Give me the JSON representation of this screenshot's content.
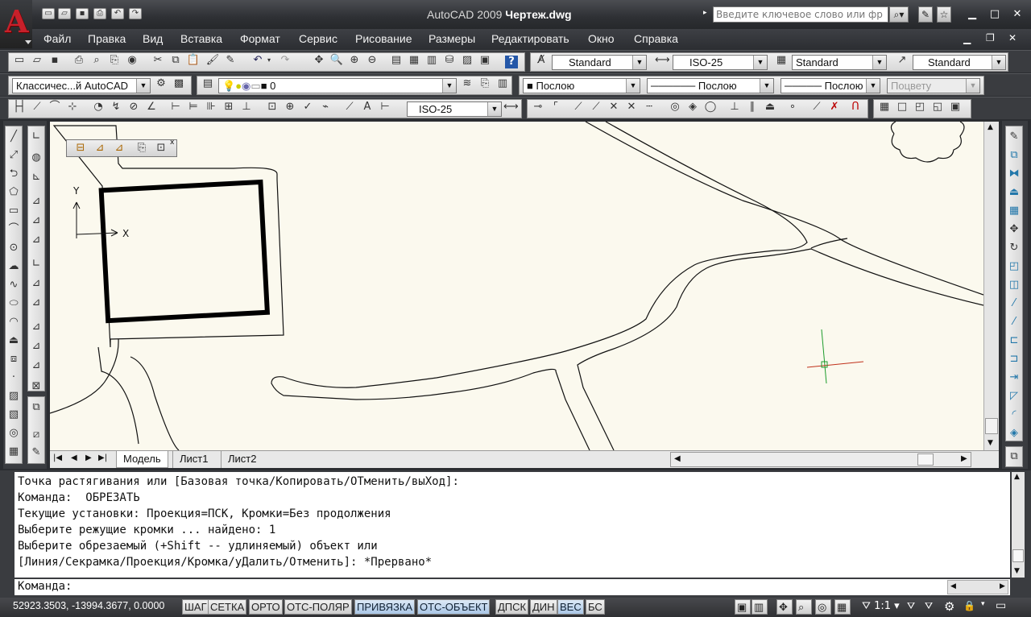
{
  "app": {
    "title_prefix": "AutoCAD 2009 ",
    "title_file": "Чертеж.dwg",
    "search_placeholder": "Введите ключевое слово или фр"
  },
  "menu": [
    "Файл",
    "Правка",
    "Вид",
    "Вставка",
    "Формат",
    "Сервис",
    "Рисование",
    "Размеры",
    "Редактировать",
    "Окно",
    "Справка"
  ],
  "toolbar": {
    "text_style": "Standard",
    "dim_style": "ISO-25",
    "table_style": "Standard",
    "mleader_style": "Standard",
    "workspace": "Классичес...й AutoCAD",
    "layer": "0",
    "color": "Послою",
    "linetype": "Послою",
    "lineweight": "Послою",
    "plotstyle": "Поцвету",
    "dim_style2": "ISO-25"
  },
  "tabs": [
    "Модель",
    "Лист1",
    "Лист2"
  ],
  "ucs": {
    "x": "X",
    "y": "Y"
  },
  "command": {
    "history": [
      "Точка растягивания или [Базовая точка/Копировать/ОТменить/выХод]:",
      "Команда:  ОБРЕЗАТЬ",
      "Текущие установки: Проекция=ПСК, Кромки=Без продолжения",
      "Выберите режущие кромки ... найдено: 1",
      "Выберите обрезаемый (+Shift -- удлиняемый) объект или",
      "[Линия/Секрамка/Проекция/Кромка/уДалить/Отменить]: *Прервано*"
    ],
    "prompt": "Команда:"
  },
  "status": {
    "coords": "52923.3503, -13994.3677, 0.0000",
    "buttons": [
      {
        "label": "ШАГ",
        "on": false
      },
      {
        "label": "СЕТКА",
        "on": false
      },
      {
        "label": "ОРТО",
        "on": false
      },
      {
        "label": "ОТС-ПОЛЯР",
        "on": false
      },
      {
        "label": "ПРИВЯЗКА",
        "on": true
      },
      {
        "label": "ОТС-ОБЪЕКТ",
        "on": true
      },
      {
        "label": "ДПСК",
        "on": false
      },
      {
        "label": "ДИН",
        "on": false
      },
      {
        "label": "ВЕС",
        "on": true
      },
      {
        "label": "БС",
        "on": false
      }
    ],
    "scale": "1:1"
  }
}
